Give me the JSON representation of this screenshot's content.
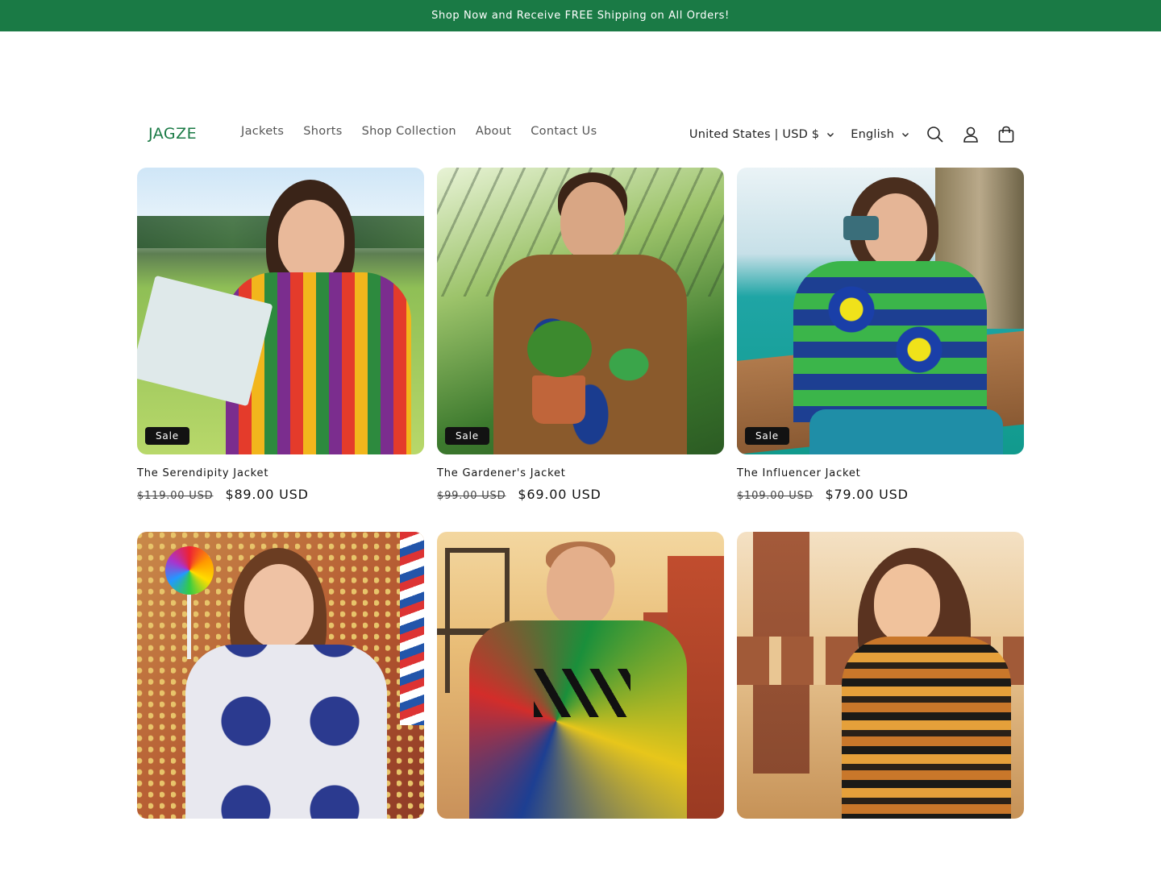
{
  "announcement": {
    "text": "Shop Now and Receive FREE Shipping on All Orders!"
  },
  "header": {
    "logo": "JAGZE",
    "nav": [
      "Jackets",
      "Shorts",
      "Shop Collection",
      "About",
      "Contact Us"
    ],
    "country_selector": "United States | USD $",
    "language_selector": "English",
    "icons": [
      "search-icon",
      "account-icon",
      "cart-icon"
    ]
  },
  "products": [
    {
      "title": "The Serendipity Jacket",
      "badge": "Sale",
      "compare_price": "$119.00 USD",
      "price": "$89.00 USD"
    },
    {
      "title": "The Gardener's Jacket",
      "badge": "Sale",
      "compare_price": "$99.00 USD",
      "price": "$69.00 USD"
    },
    {
      "title": "The Influencer Jacket",
      "badge": "Sale",
      "compare_price": "$109.00 USD",
      "price": "$79.00 USD"
    },
    {
      "title": "",
      "badge": "",
      "compare_price": "",
      "price": ""
    },
    {
      "title": "",
      "badge": "",
      "compare_price": "",
      "price": ""
    },
    {
      "title": "",
      "badge": "",
      "compare_price": "",
      "price": ""
    }
  ],
  "colors": {
    "announcement_bg": "#1a7a45",
    "logo": "#1a7a45",
    "badge_bg": "#121212"
  }
}
